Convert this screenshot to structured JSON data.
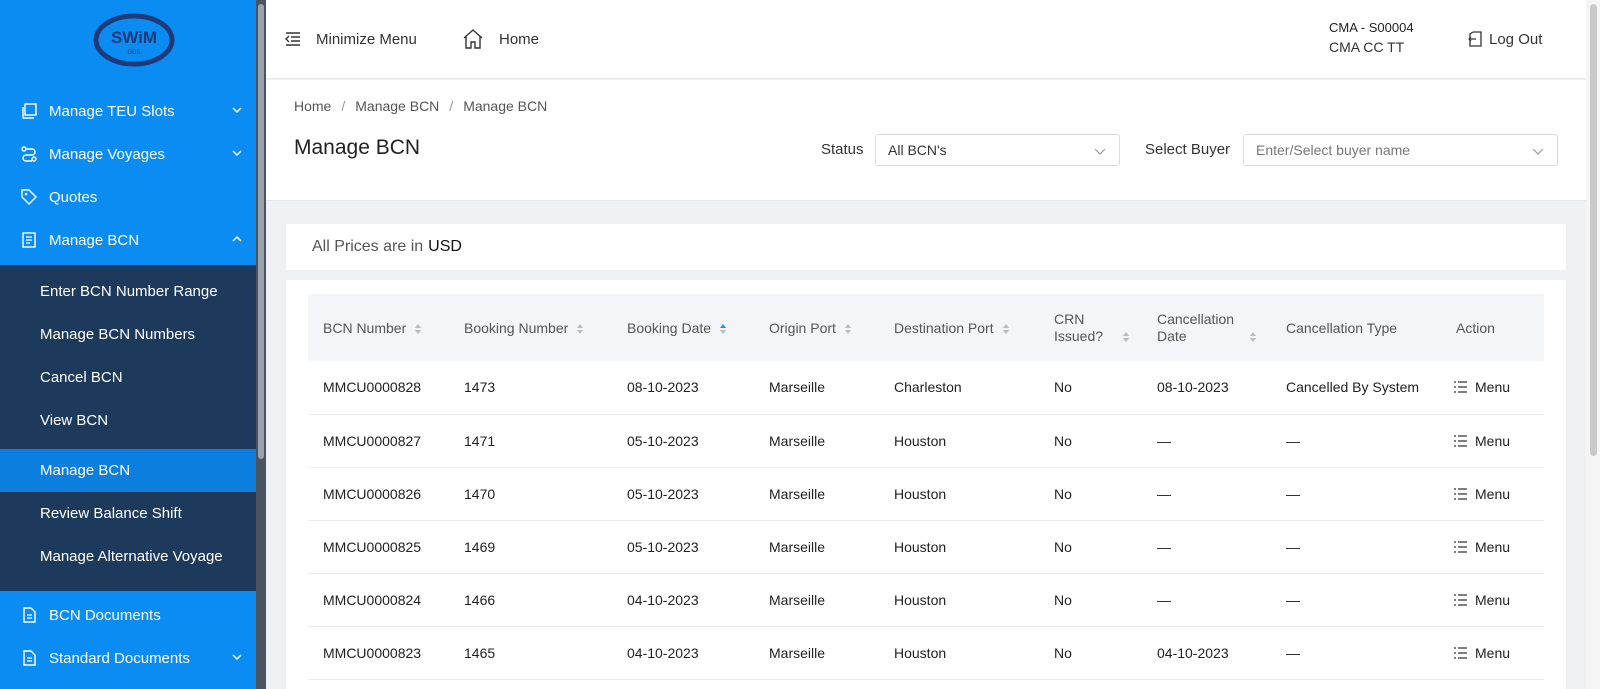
{
  "brand": {
    "logo_text": "SWiM",
    "logo_sub": "GDS"
  },
  "sidebar": {
    "items": [
      {
        "label": "Manage TEU Slots",
        "icon": "copy-icon",
        "chevron": "down"
      },
      {
        "label": "Manage Voyages",
        "icon": "route-icon",
        "chevron": "down"
      },
      {
        "label": "Quotes",
        "icon": "tag-icon",
        "chevron": ""
      },
      {
        "label": "Manage BCN",
        "icon": "document-icon",
        "chevron": "up"
      },
      {
        "label": "BCN Documents",
        "icon": "file-icon",
        "chevron": ""
      },
      {
        "label": "Standard Documents",
        "icon": "file-icon",
        "chevron": "down"
      }
    ],
    "submenu": [
      "Enter BCN Number Range",
      "Manage BCN Numbers",
      "Cancel BCN",
      "View BCN",
      "Manage BCN",
      "Review Balance Shift",
      "Manage Alternative Voyage"
    ],
    "active_submenu": "Manage BCN"
  },
  "topbar": {
    "minimize_label": "Minimize Menu",
    "home_label": "Home",
    "user_id": "CMA - S00004",
    "user_name": "CMA CC TT",
    "logout_label": "Log Out"
  },
  "header": {
    "breadcrumb": [
      "Home",
      "Manage BCN",
      "Manage BCN"
    ],
    "title": "Manage BCN",
    "status_label": "Status",
    "status_value": "All BCN's",
    "buyer_label": "Select Buyer",
    "buyer_placeholder": "Enter/Select buyer name"
  },
  "notice": {
    "prefix": "All Prices are in",
    "currency": "USD"
  },
  "table": {
    "columns": [
      {
        "label": "BCN Number",
        "sort": "both"
      },
      {
        "label": "Booking Number",
        "sort": "both"
      },
      {
        "label": "Booking Date",
        "sort": "asc"
      },
      {
        "label": "Origin Port",
        "sort": "both"
      },
      {
        "label": "Destination Port",
        "sort": "both"
      },
      {
        "label": "CRN Issued?",
        "sort": "both"
      },
      {
        "label": "Cancellation Date",
        "sort": "both"
      },
      {
        "label": "Cancellation Type",
        "sort": ""
      },
      {
        "label": "Action",
        "sort": ""
      }
    ],
    "menu_label": "Menu",
    "rows": [
      [
        "MMCU0000828",
        "1473",
        "08-10-2023",
        "Marseille",
        "Charleston",
        "No",
        "08-10-2023",
        "Cancelled By System"
      ],
      [
        "MMCU0000827",
        "1471",
        "05-10-2023",
        "Marseille",
        "Houston",
        "No",
        "—",
        "—"
      ],
      [
        "MMCU0000826",
        "1470",
        "05-10-2023",
        "Marseille",
        "Houston",
        "No",
        "—",
        "—"
      ],
      [
        "MMCU0000825",
        "1469",
        "05-10-2023",
        "Marseille",
        "Houston",
        "No",
        "—",
        "—"
      ],
      [
        "MMCU0000824",
        "1466",
        "04-10-2023",
        "Marseille",
        "Houston",
        "No",
        "—",
        "—"
      ],
      [
        "MMCU0000823",
        "1465",
        "04-10-2023",
        "Marseille",
        "Houston",
        "No",
        "04-10-2023",
        "—"
      ]
    ]
  },
  "colors": {
    "sidebar": "#0b8cf2",
    "submenu": "#1d3a5c",
    "active": "#0b7ee0",
    "sort_active": "#1890ff"
  }
}
